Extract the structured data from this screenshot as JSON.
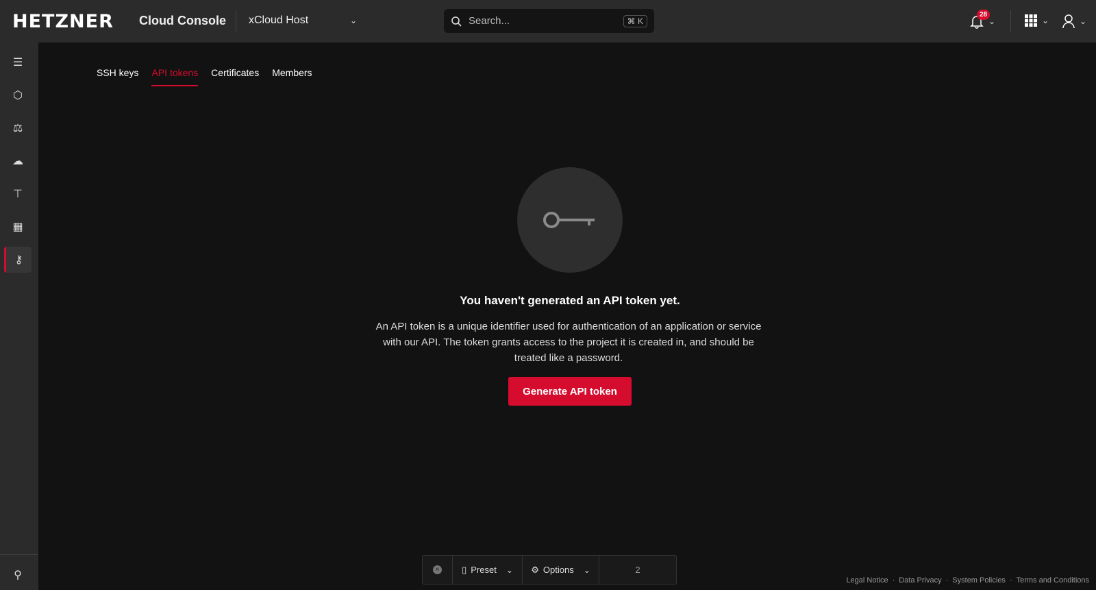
{
  "header": {
    "logo": "HETZNER",
    "app_title": "Cloud Console",
    "project": "xCloud Host",
    "search_placeholder": "Search...",
    "search_shortcut": "⌘ K",
    "notifications_count": "28"
  },
  "sidebar": {
    "items": [
      "servers",
      "cloud-apps",
      "load-balancers",
      "volumes",
      "networks",
      "firewalls",
      "security"
    ],
    "active": "security"
  },
  "tabs": [
    {
      "label": "SSH keys"
    },
    {
      "label": "API tokens"
    },
    {
      "label": "Certificates"
    },
    {
      "label": "Members"
    }
  ],
  "empty_state": {
    "title": "You haven't generated an API token yet.",
    "description": "An API token is a unique identifier used for authentication of an application or service with our API. The token grants access to the project it is created in, and should be treated like a password.",
    "button": "Generate API token"
  },
  "toolbar": {
    "preset": "Preset",
    "options": "Options",
    "count": "2"
  },
  "footer": [
    "Legal Notice",
    "Data Privacy",
    "System Policies",
    "Terms and Conditions"
  ],
  "colors": {
    "accent": "#d50c2d",
    "header": "#2b2b2b",
    "background": "#121212"
  }
}
